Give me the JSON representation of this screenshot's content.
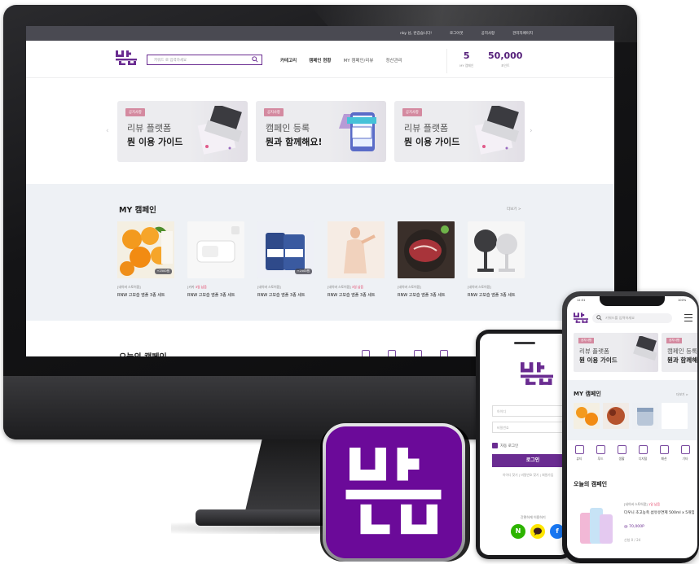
{
  "desktop": {
    "utility_links": [
      "nky 님, 반갑습니다!",
      "로그아웃",
      "공지사항",
      "관리자페이지"
    ],
    "search_placeholder": "키워드 로 입력하세요",
    "nav": [
      "카테고리",
      "캠페인 현황",
      "MY 캠페인/리뷰",
      "정산관리"
    ],
    "stats": [
      {
        "value": "5",
        "label": "MY 캠페인"
      },
      {
        "value": "50,000",
        "label": "포인트"
      }
    ],
    "banners": [
      {
        "tag": "공지사항",
        "line1": "리뷰 플랫폼",
        "line2": "뭔 이용 가이드"
      },
      {
        "tag": "공지사항",
        "line1": "캠페인 등록",
        "line2": "뭔과 함께해요!"
      },
      {
        "tag": "공지사항",
        "line1": "리뷰 플랫폼",
        "line2": "뭔 이용 가이드"
      }
    ],
    "my_campaign_title": "MY 캠페인",
    "my_campaign_more": "더보기 >",
    "products": [
      {
        "meta": "[네이버 스토어팜]",
        "hot": "",
        "title": "RNW 고보습 앰플 3종 세트",
        "badge": "+2500원"
      },
      {
        "meta": "[카카",
        "hot": "3일 남음",
        "title": "RNW 고보습 앰플 3종 세트",
        "badge": ""
      },
      {
        "meta": "[네이버 스토어팜]",
        "hot": "",
        "title": "RNW 고보습 앰플 3종 세트",
        "badge": "+2500원"
      },
      {
        "meta": "[네이버 스토어팜]",
        "hot": "3일 남음",
        "title": "RNW 고보습 앰플 3종 세트",
        "badge": ""
      },
      {
        "meta": "[네이버 스토어팜]",
        "hot": "",
        "title": "RNW 고보습 앰플 3종 세트",
        "badge": ""
      },
      {
        "meta": "[네이버 스토어팜]",
        "hot": "",
        "title": "RNW 고보습 앰플 3종 세트",
        "badge": ""
      }
    ],
    "today_title": "오늘의 캠페인"
  },
  "phone_login": {
    "id_placeholder": "아이디",
    "pw_placeholder": "비밀번호",
    "auto_login": "자동 로그인",
    "login_button": "로그인",
    "links": "아이디 찾기 | 비밀번호 찾기 | 회원가입",
    "sns_label": "간편하게 이용하기",
    "sns": [
      {
        "label": "N",
        "color": "#2db400"
      },
      {
        "label": "•",
        "color": "#fee500"
      },
      {
        "label": "f",
        "color": "#1877f2"
      }
    ]
  },
  "phone_main": {
    "status_time": "12:31",
    "status_battery": "100%",
    "search_placeholder": "키워드를 입력하세요",
    "banners": [
      {
        "tag": "공지사항",
        "line1": "리뷰 플랫폼",
        "line2": "뭔 이용 가이드"
      },
      {
        "tag": "공지사항",
        "line1": "캠페인 등록",
        "line2": "뭔과 함께해"
      }
    ],
    "my_campaign_title": "MY 캠페인",
    "more": "더보기 >",
    "categories": [
      "뷰티",
      "푸드",
      "생활",
      "디지털",
      "패션",
      "기타"
    ],
    "today_title": "오늘의 캠페인",
    "item": {
      "meta": "[네이버 스토어팜]",
      "hot": "1일 남음",
      "title": "다우니 초고농축 섬유유연제 500ml x 5개입",
      "price": "@ 70,000P",
      "count": "신청 0 / 24"
    }
  },
  "colors": {
    "brand": "#6a2c91",
    "app_icon_bg": "#6b0a99",
    "hot": "#e2335a"
  }
}
